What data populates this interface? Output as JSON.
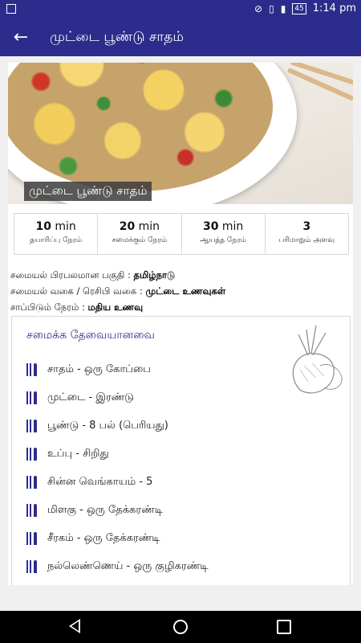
{
  "status_bar": {
    "time": "1:14 pm",
    "battery": "45",
    "icons": [
      "image-icon",
      "do-not-disturb-icon",
      "vibrate-icon",
      "signal-icon",
      "battery-icon"
    ]
  },
  "app_bar": {
    "title": "முட்டை பூண்டு சாதம்",
    "back_icon": "arrow-left-icon"
  },
  "hero": {
    "caption": "முட்டை பூண்டு சாதம்"
  },
  "stats": [
    {
      "value": "10",
      "unit": "min",
      "label": "தயாரிப்பு நேரம்"
    },
    {
      "value": "20",
      "unit": "min",
      "label": "சமைக்கும் நேரம்"
    },
    {
      "value": "30",
      "unit": "min",
      "label": "ஆயத்த நேரம்"
    },
    {
      "value": "3",
      "unit": "",
      "label": "பரிமாறும் அளவு"
    }
  ],
  "info": {
    "region_label": "சமையல் பிரபலமான பகுதி :",
    "region_value": "தமிழ்நாடு",
    "type_label": "சமையல் வகை / ரெசிபி வகை :",
    "type_value": "முட்டை உணவுகள்",
    "time_label": "சாப்பிடும் நேரம் :",
    "time_value": "மதிய உணவு"
  },
  "ingredients": {
    "title": "சமைக்க தேவையானவை",
    "items": [
      "சாதம் - ஒரு கோப்பை",
      "முட்டை - இரண்டு",
      "பூண்டு - 8 பல் (பெரியது)",
      "உப்பு - சிறிது",
      "சின்ன வெங்காயம் - 5",
      "மிளகு - ஒரு தேக்கரண்டி",
      "சீரகம் - ஒரு தேக்கரண்டி",
      "நல்லெண்ணெய் - ஒரு குழிகரண்டி"
    ]
  },
  "colors": {
    "primary": "#2c2c8c",
    "accent_text": "#2c2c8c"
  }
}
